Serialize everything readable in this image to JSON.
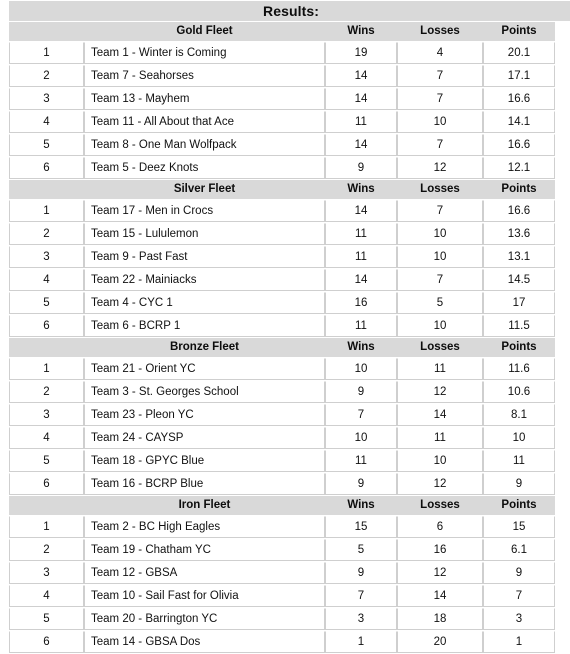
{
  "page": {
    "title": "Results:"
  },
  "columns": {
    "rank": "",
    "wins": "Wins",
    "losses": "Losses",
    "points": "Points"
  },
  "fleets": [
    {
      "name": "Gold Fleet",
      "rows": [
        {
          "rank": "1",
          "team": "Team 1 - Winter is Coming",
          "wins": "19",
          "losses": "4",
          "points": "20.1"
        },
        {
          "rank": "2",
          "team": "Team 7 - Seahorses",
          "wins": "14",
          "losses": "7",
          "points": "17.1"
        },
        {
          "rank": "3",
          "team": "Team 13 - Mayhem",
          "wins": "14",
          "losses": "7",
          "points": "16.6"
        },
        {
          "rank": "4",
          "team": "Team 11 - All About that Ace",
          "wins": "11",
          "losses": "10",
          "points": "14.1"
        },
        {
          "rank": "5",
          "team": "Team 8 - One Man Wolfpack",
          "wins": "14",
          "losses": "7",
          "points": "16.6"
        },
        {
          "rank": "6",
          "team": "Team 5 - Deez Knots",
          "wins": "9",
          "losses": "12",
          "points": "12.1"
        }
      ]
    },
    {
      "name": "Silver Fleet",
      "rows": [
        {
          "rank": "1",
          "team": "Team 17 - Men in Crocs",
          "wins": "14",
          "losses": "7",
          "points": "16.6"
        },
        {
          "rank": "2",
          "team": "Team 15 - Lululemon",
          "wins": "11",
          "losses": "10",
          "points": "13.6"
        },
        {
          "rank": "3",
          "team": "Team 9 - Past Fast",
          "wins": "11",
          "losses": "10",
          "points": "13.1"
        },
        {
          "rank": "4",
          "team": "Team 22 - Mainiacks",
          "wins": "14",
          "losses": "7",
          "points": "14.5"
        },
        {
          "rank": "5",
          "team": "Team 4 - CYC 1",
          "wins": "16",
          "losses": "5",
          "points": "17"
        },
        {
          "rank": "6",
          "team": "Team 6 - BCRP 1",
          "wins": "11",
          "losses": "10",
          "points": "11.5"
        }
      ]
    },
    {
      "name": "Bronze Fleet",
      "rows": [
        {
          "rank": "1",
          "team": "Team 21 - Orient YC",
          "wins": "10",
          "losses": "11",
          "points": "11.6"
        },
        {
          "rank": "2",
          "team": "Team 3 - St. Georges School",
          "wins": "9",
          "losses": "12",
          "points": "10.6"
        },
        {
          "rank": "3",
          "team": "Team 23 - Pleon YC",
          "wins": "7",
          "losses": "14",
          "points": "8.1"
        },
        {
          "rank": "4",
          "team": "Team 24 - CAYSP",
          "wins": "10",
          "losses": "11",
          "points": "10"
        },
        {
          "rank": "5",
          "team": "Team 18 - GPYC Blue",
          "wins": "11",
          "losses": "10",
          "points": "11"
        },
        {
          "rank": "6",
          "team": "Team 16 - BCRP Blue",
          "wins": "9",
          "losses": "12",
          "points": "9"
        }
      ]
    },
    {
      "name": "Iron Fleet",
      "rows": [
        {
          "rank": "1",
          "team": "Team 2 - BC High Eagles",
          "wins": "15",
          "losses": "6",
          "points": "15"
        },
        {
          "rank": "2",
          "team": "Team 19 - Chatham YC",
          "wins": "5",
          "losses": "16",
          "points": "6.1"
        },
        {
          "rank": "3",
          "team": "Team 12 - GBSA",
          "wins": "9",
          "losses": "12",
          "points": "9"
        },
        {
          "rank": "4",
          "team": "Team 10 - Sail Fast for Olivia",
          "wins": "7",
          "losses": "14",
          "points": "7"
        },
        {
          "rank": "5",
          "team": "Team 20 - Barrington YC",
          "wins": "3",
          "losses": "18",
          "points": "3"
        },
        {
          "rank": "6",
          "team": "Team 14 - GBSA Dos",
          "wins": "1",
          "losses": "20",
          "points": "1"
        }
      ]
    }
  ],
  "colors": {
    "header_bg": "#d9d9d9",
    "row_bg": "#ffffff",
    "border": "#cfcfcf",
    "text": "#111111"
  }
}
